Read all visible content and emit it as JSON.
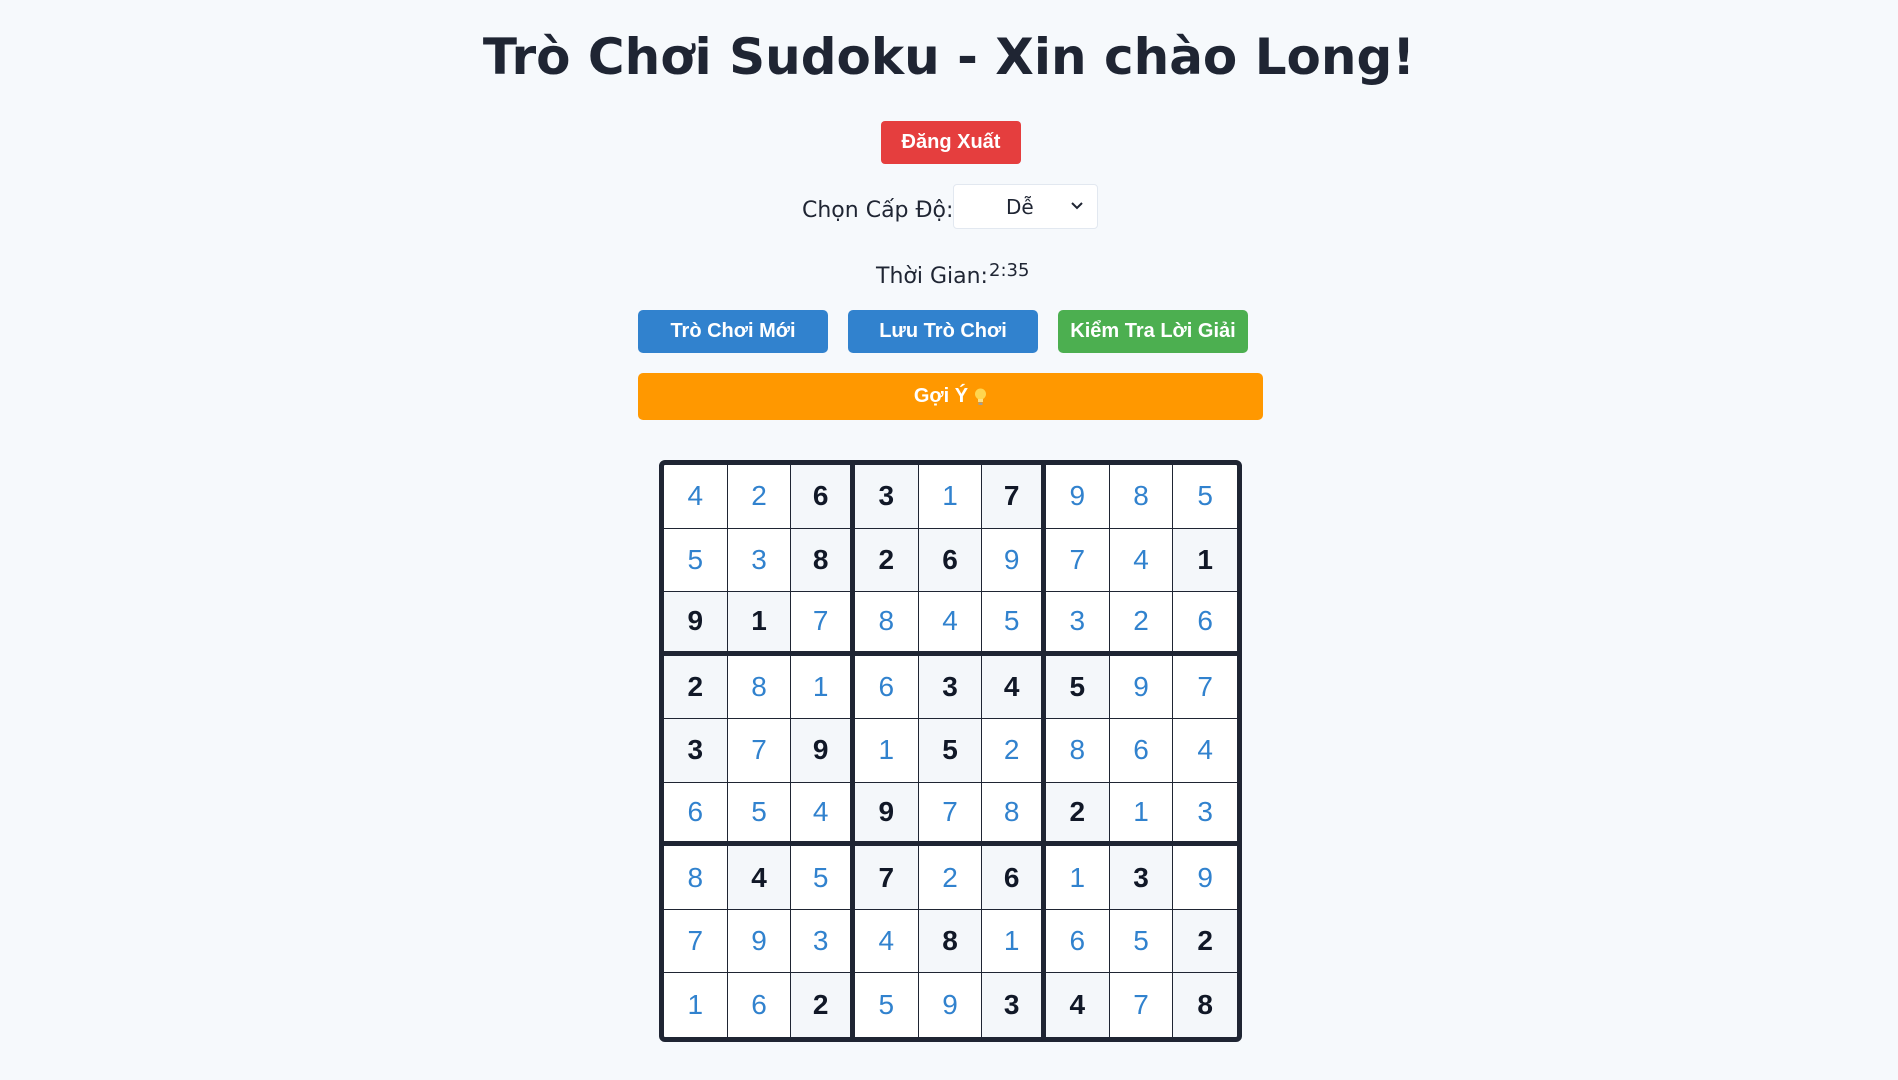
{
  "header": {
    "title": "Trò Chơi Sudoku - Xin chào Long!"
  },
  "logout_label": "Đăng Xuất",
  "level": {
    "label": "Chọn Cấp Độ:",
    "selected": "Dễ"
  },
  "timer": {
    "label": "Thời Gian:",
    "value": "2:35"
  },
  "actions": {
    "new_game": "Trò Chơi Mới",
    "save_game": "Lưu Trò Chơi",
    "check_solution": "Kiểm Tra Lời Giải",
    "hint": "Gợi Ý"
  },
  "colors": {
    "logout": "#e53e3e",
    "primary": "#3182ce",
    "check": "#4caf50",
    "hint": "#ff9800",
    "user_digit": "#3182ce",
    "given_digit": "#111827"
  },
  "board": {
    "rows": [
      [
        4,
        2,
        6,
        3,
        1,
        7,
        9,
        8,
        5
      ],
      [
        5,
        3,
        8,
        2,
        6,
        9,
        7,
        4,
        1
      ],
      [
        9,
        1,
        7,
        8,
        4,
        5,
        3,
        2,
        6
      ],
      [
        2,
        8,
        1,
        6,
        3,
        4,
        5,
        9,
        7
      ],
      [
        3,
        7,
        9,
        1,
        5,
        2,
        8,
        6,
        4
      ],
      [
        6,
        5,
        4,
        9,
        7,
        8,
        2,
        1,
        3
      ],
      [
        8,
        4,
        5,
        7,
        2,
        6,
        1,
        3,
        9
      ],
      [
        7,
        9,
        3,
        4,
        8,
        1,
        6,
        5,
        2
      ],
      [
        1,
        6,
        2,
        5,
        9,
        3,
        4,
        7,
        8
      ]
    ],
    "given": [
      [
        0,
        0,
        1,
        1,
        0,
        1,
        0,
        0,
        0
      ],
      [
        0,
        0,
        1,
        1,
        1,
        0,
        0,
        0,
        1
      ],
      [
        1,
        1,
        0,
        0,
        0,
        0,
        0,
        0,
        0
      ],
      [
        1,
        0,
        0,
        0,
        1,
        1,
        1,
        0,
        0
      ],
      [
        1,
        0,
        1,
        0,
        1,
        0,
        0,
        0,
        0
      ],
      [
        0,
        0,
        0,
        1,
        0,
        0,
        1,
        0,
        0
      ],
      [
        0,
        1,
        0,
        1,
        0,
        1,
        0,
        1,
        0
      ],
      [
        0,
        0,
        0,
        0,
        1,
        0,
        0,
        0,
        1
      ],
      [
        0,
        0,
        1,
        0,
        0,
        1,
        1,
        0,
        1
      ]
    ]
  }
}
